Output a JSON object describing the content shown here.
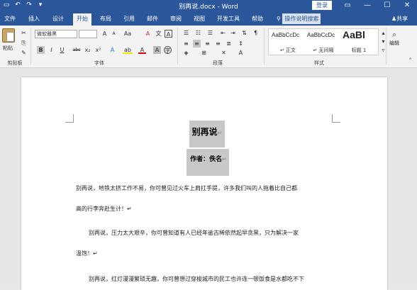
{
  "titlebar": {
    "title": "别再说.docx - Word",
    "login_label": "登录",
    "qat": {
      "save_glyph": "▭",
      "undo_glyph": "↶",
      "redo_glyph": "↷",
      "more_glyph": "▾"
    },
    "controls": {
      "restore": "▭",
      "minimize": "—",
      "maximize": "☐",
      "close": "✕"
    }
  },
  "tabs": [
    {
      "label": "文件"
    },
    {
      "label": "插入"
    },
    {
      "label": "设计"
    },
    {
      "label": "开始"
    },
    {
      "label": "布局"
    },
    {
      "label": "引用"
    },
    {
      "label": "邮件"
    },
    {
      "label": "审阅"
    },
    {
      "label": "视图"
    },
    {
      "label": "开发工具"
    },
    {
      "label": "帮助"
    }
  ],
  "tellme": {
    "placeholder": "操作说明搜索"
  },
  "share": {
    "label": "共享"
  },
  "ribbon": {
    "clipboard": {
      "paste_label": "粘贴",
      "group_label": "剪贴板"
    },
    "font": {
      "font_name": "微软雅黑",
      "font_size": "",
      "group_label": "字体",
      "buttons": {
        "bold": "B",
        "italic": "I",
        "underline": "U",
        "strike": "abc",
        "subscript": "x₂",
        "superscript": "x²",
        "grow": "A",
        "shrink": "A",
        "case": "Aa",
        "clear": "A",
        "phonetic": "文",
        "border": "A",
        "effects": "A",
        "highlight": "ab",
        "color": "A",
        "shading": "A",
        "circle": "字"
      }
    },
    "paragraph": {
      "group_label": "段落"
    },
    "styles": {
      "group_label": "样式",
      "items": [
        {
          "preview": "AaBbCcDc",
          "name": "↵ 正文"
        },
        {
          "preview": "AaBbCcDc",
          "name": "↵ 无间隔"
        },
        {
          "preview": "AaBl",
          "name": "标题 1"
        }
      ]
    },
    "editing": {
      "label": "编辑"
    }
  },
  "document": {
    "title": "别再说",
    "author": "作者：佚名",
    "paragraphs": [
      "别再说，地铁太挤工作不易，你可曾见过火车上肩扛手提，许多我们叫的人拖着比自己都",
      "高的行李奔赴生计！↵",
      "别再说，压力太大艰辛，你可曾知道有人已经年逾古稀依然起早贪黑，只为解决一家",
      "温饱！↵",
      "别再说，红灯漫漫繁琐无趣，你可曾想过穿梭城市的民工也许连一顿饭食是水都吃不下"
    ]
  }
}
